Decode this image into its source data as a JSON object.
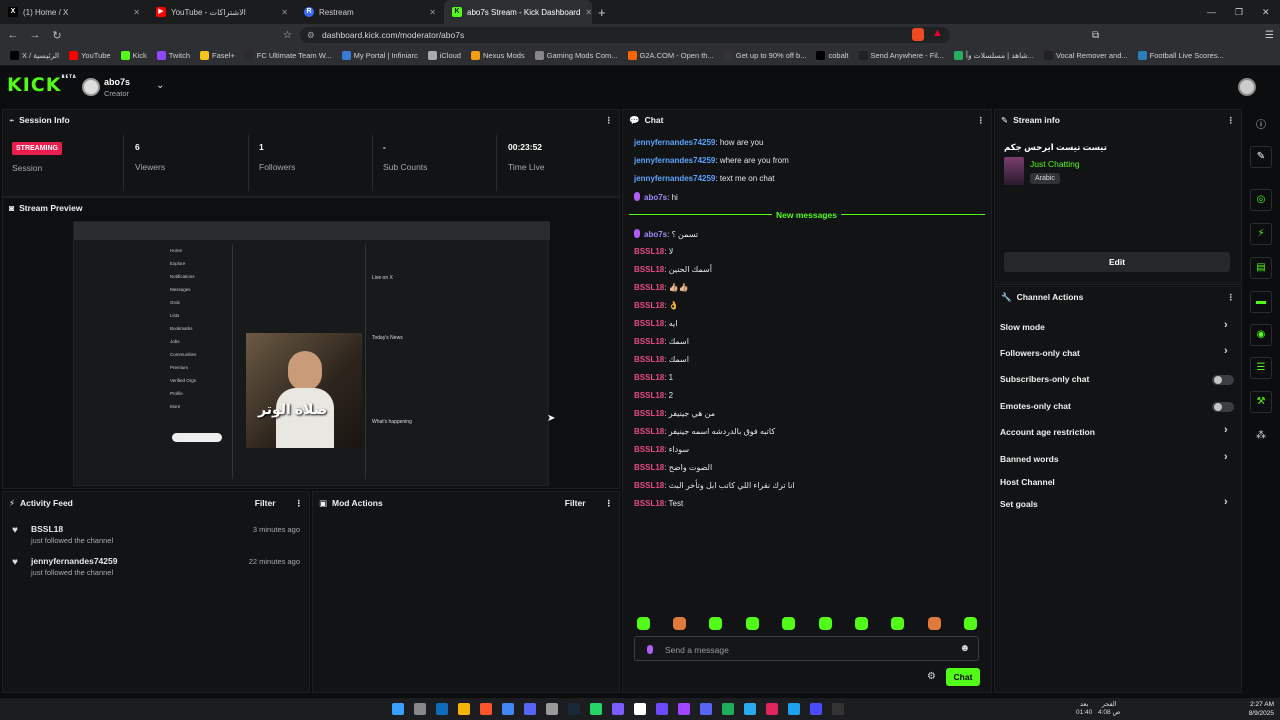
{
  "browser": {
    "tabs": [
      {
        "title": "(1) Home / X",
        "icon": "x-icon"
      },
      {
        "title": "YouTube - الاشتراكات",
        "icon": "youtube-icon"
      },
      {
        "title": "Restream",
        "icon": "restream-icon"
      },
      {
        "title": "abo7s Stream - Kick Dashboard",
        "icon": "kick-icon"
      }
    ],
    "url": "dashboard.kick.com/moderator/abo7s",
    "bookmarks": [
      "X / الرئيسية",
      "YouTube",
      "Kick",
      "Twitch",
      "Fasel+",
      "FC Ultimate Team W...",
      "My Portal | Infiniarc",
      "iCloud",
      "Nexus Mods",
      "Gaming Mods Com...",
      "G2A.COM - Open th...",
      "Get up to 90% off b...",
      "cobalt",
      "Send Anywhere - Fil...",
      "شاهد | مسلسلات وأ...",
      "Vocal Remover and...",
      "Football Live Scores..."
    ]
  },
  "header": {
    "logo": "KICK",
    "logo_tag": "BETA",
    "username": "abo7s",
    "role": "Creator"
  },
  "session": {
    "title": "Session Info",
    "status": "STREAMING",
    "status_label": "Session",
    "stats": [
      {
        "value": "6",
        "label": "Viewers"
      },
      {
        "value": "1",
        "label": "Followers"
      },
      {
        "value": "-",
        "label": "Sub Counts"
      },
      {
        "value": "00:23:52",
        "label": "Time Live"
      }
    ]
  },
  "preview": {
    "title": "Stream Preview",
    "overlay_text": "صلاة الوتر"
  },
  "activity": {
    "title": "Activity Feed",
    "filter": "Filter",
    "items": [
      {
        "user": "BSSL18",
        "action": "just followed the channel",
        "time": "3 minutes ago"
      },
      {
        "user": "jennyfernandes74259",
        "action": "just followed the channel",
        "time": "22 minutes ago"
      }
    ]
  },
  "mod": {
    "title": "Mod Actions",
    "filter": "Filter"
  },
  "chat": {
    "title": "Chat",
    "old": [
      {
        "user": "jennyfernandes74259",
        "text": ": how are you"
      },
      {
        "user": "jennyfernandes74259",
        "text": ": where are you from"
      },
      {
        "user": "jennyfernandes74259",
        "text": ": text me on chat"
      },
      {
        "user": "abo7s",
        "text": ": hi"
      }
    ],
    "new_label": "New messages",
    "new": [
      {
        "user": "abo7s",
        "text": ": تسمن ؟"
      },
      {
        "user": "BSSL18",
        "text": ": لا"
      },
      {
        "user": "BSSL18",
        "text": ": أسمك الحنين"
      },
      {
        "user": "BSSL18",
        "text": ": 👍🏼👍🏼"
      },
      {
        "user": "BSSL18",
        "text": ": 👌"
      },
      {
        "user": "BSSL18",
        "text": ": ايه"
      },
      {
        "user": "BSSL18",
        "text": ": اسمك"
      },
      {
        "user": "BSSL18",
        "text": ": اسمك"
      },
      {
        "user": "BSSL18",
        "text": ": 1"
      },
      {
        "user": "BSSL18",
        "text": ": 2"
      },
      {
        "user": "BSSL18",
        "text": ": من هي جينيفر"
      },
      {
        "user": "BSSL18",
        "text": ": كاتبه فوق بالدردشه اسمه جينيفر"
      },
      {
        "user": "BSSL18",
        "text": ": سوداء"
      },
      {
        "user": "BSSL18",
        "text": ": الصوت واضح"
      },
      {
        "user": "BSSL18",
        "text": ": انا ترك نقراء اللي كاتب ابل وتأخر البث"
      },
      {
        "user": "BSSL18",
        "text": ": Test"
      }
    ],
    "placeholder": "Send a message",
    "send": "Chat"
  },
  "stream_info": {
    "title": "Stream info",
    "stream_title": "تيست تيست ايرحس جكم",
    "category": "Just Chatting",
    "tag": "Arabic",
    "edit": "Edit"
  },
  "channel_actions": {
    "title": "Channel Actions",
    "items": [
      {
        "label": "Slow mode",
        "control": "chevron"
      },
      {
        "label": "Followers-only chat",
        "control": "chevron"
      },
      {
        "label": "Subscribers-only chat",
        "control": "toggle",
        "enabled": false
      },
      {
        "label": "Emotes-only chat",
        "control": "toggle",
        "enabled": false
      },
      {
        "label": "Account age restriction",
        "control": "chevron"
      },
      {
        "label": "Banned words",
        "control": "chevron"
      },
      {
        "label": "Host Channel",
        "control": "none"
      },
      {
        "label": "Set goals",
        "control": "chevron"
      }
    ]
  },
  "taskbar": {
    "time": "2:27 AM",
    "date": "8/9/2025",
    "prayer": "الفجر",
    "prayer_time": "4:08 ص",
    "next": "بعد",
    "next_time": "01:40"
  },
  "colors": {
    "accent": "#53fc18",
    "live": "#e91e50",
    "link_user": "#5da4ff",
    "user_pink": "#e84b82"
  }
}
